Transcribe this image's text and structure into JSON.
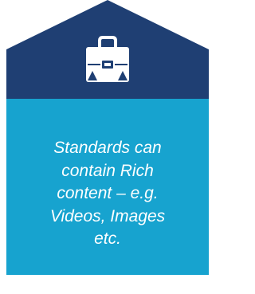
{
  "card": {
    "icon": "briefcase-icon",
    "text": "Standards can\ncontain Rich\ncontent – e.g.\nVideos, Images\netc."
  },
  "colors": {
    "header": "#1f3f73",
    "body": "#17a3cf",
    "icon": "#ffffff",
    "text": "#ffffff"
  }
}
